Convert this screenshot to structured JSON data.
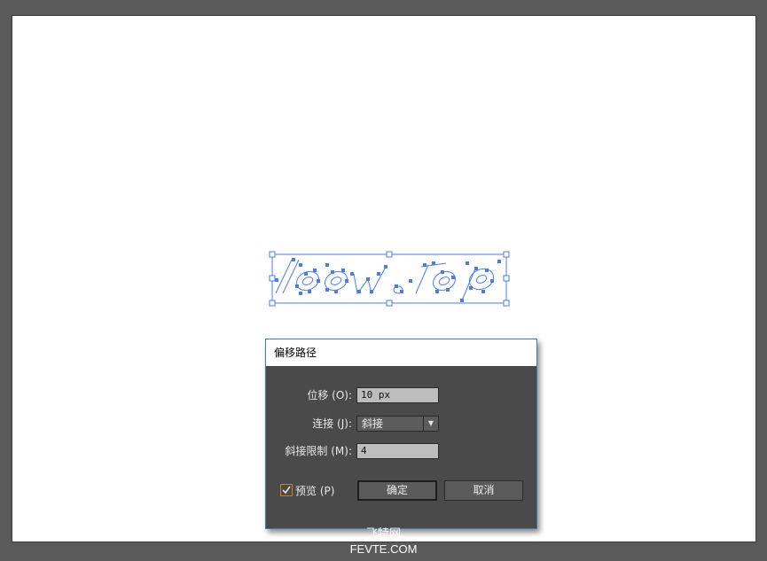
{
  "dialog": {
    "title": "偏移路径",
    "offset_label": "位移 (O):",
    "offset_value": "10 px",
    "joins_label": "连接 (J):",
    "joins_value": "斜接",
    "miter_label": "斜接限制 (M):",
    "miter_value": "4",
    "preview_label": "预览 (P)",
    "preview_checked": true,
    "ok_label": "确定",
    "cancel_label": "取消"
  },
  "watermark": {
    "line1": "飞特网",
    "line2": "FEVTE.COM"
  },
  "colors": {
    "selection": "#4a7bf7",
    "dialog_border": "#3d7ab8",
    "checkbox": "#c97f2d"
  }
}
